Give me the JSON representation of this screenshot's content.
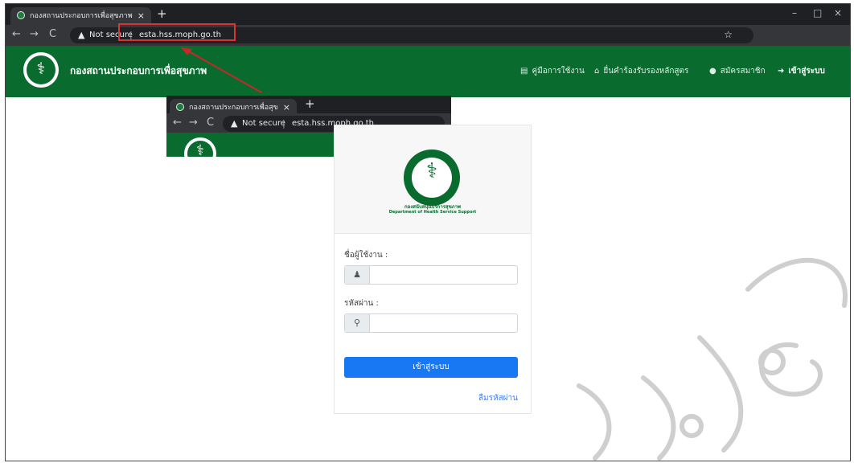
{
  "browser": {
    "tab_title": "กองสถานประกอบการเพื่อสุขภาพ กรม",
    "tab_close": "×",
    "new_tab": "+",
    "security_label": "Not secure",
    "separator": "|",
    "url": "esta.hss.moph.go.th",
    "nav": {
      "back": "←",
      "forward": "→",
      "reload": "C"
    },
    "window_controls": {
      "minimize": "–",
      "maximize": "□",
      "close": "×"
    },
    "menu_dots": "⋮",
    "star": "☆"
  },
  "inset_browser": {
    "tab_title": "กองสถานประกอบการเพื่อสุขภาพ กรม",
    "tab_close": "×",
    "new_tab": "+",
    "security_label": "Not secure",
    "separator": "|",
    "url": "esta.hss.moph.go.th",
    "nav": {
      "back": "←",
      "forward": "→",
      "reload": "C"
    }
  },
  "site": {
    "title": "กองสถานประกอบการเพื่อสุขภาพ",
    "menu": [
      {
        "icon": "book-icon",
        "glyph": "▤",
        "label": "คู่มือการใช้งาน"
      },
      {
        "icon": "building-icon",
        "glyph": "⌂",
        "label": "ยื่นคำร้องรับรองหลักสูตร"
      },
      {
        "icon": "user-icon",
        "glyph": "●",
        "label": "สมัครสมาชิก"
      },
      {
        "icon": "sign-in-icon",
        "glyph": "➜",
        "label": "เข้าสู่ระบบ"
      }
    ]
  },
  "login": {
    "dept_th": "กองสนับสนุนบริการสุขภาพ",
    "dept_en": "Department of Health Service Support",
    "username_label": "ชื่อผู้ใช้งาน :",
    "username_value": "",
    "password_label": "รหัสผ่าน :",
    "password_value": "",
    "user_icon_glyph": "👤",
    "key_icon_glyph": "🔑",
    "submit_label": "เข้าสู่ระบบ",
    "forgot_label": "ลืมรหัสผ่าน"
  },
  "colors": {
    "header_green": "#0a6b2f",
    "button_blue": "#1877f2",
    "link_blue": "#3b82f6",
    "highlight_red": "#dd3333"
  }
}
